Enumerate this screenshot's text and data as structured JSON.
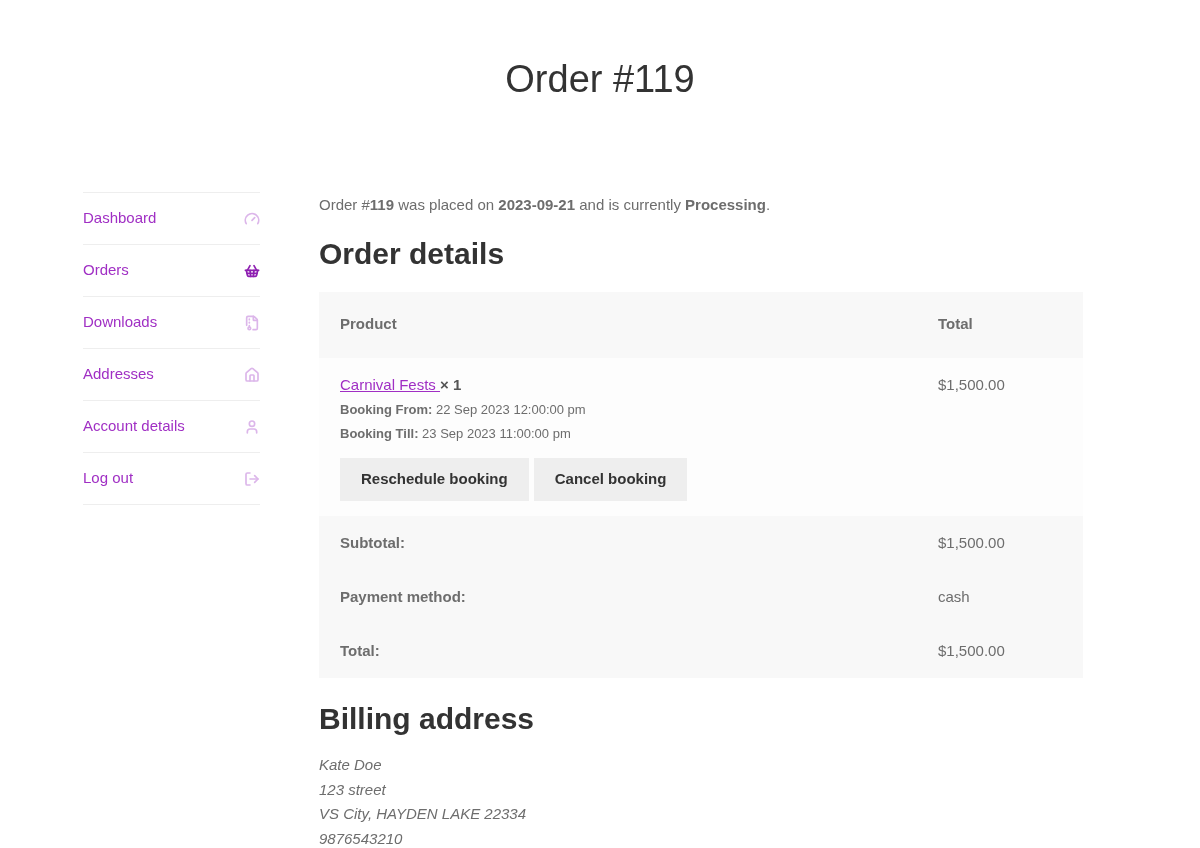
{
  "title": "Order #119",
  "nav": [
    {
      "label": "Dashboard",
      "kind": "dashboard",
      "selected": false
    },
    {
      "label": "Orders",
      "kind": "orders",
      "selected": true
    },
    {
      "label": "Downloads",
      "kind": "downloads",
      "selected": false
    },
    {
      "label": "Addresses",
      "kind": "addresses",
      "selected": false
    },
    {
      "label": "Account details",
      "kind": "account",
      "selected": false
    },
    {
      "label": "Log out",
      "kind": "logout",
      "selected": false
    }
  ],
  "intro": "Order #**119** was placed on **2023-09-21** and is currently **Processing**.",
  "order_details": {
    "heading": "Order details",
    "columns": [
      "Product",
      "Total"
    ],
    "item": {
      "product": "Carnival Fests ",
      "quantity": "× 1",
      "meta": [
        "**Booking From:** 22 Sep 2023 12:00:00 pm",
        "**Booking Till:** 23 Sep 2023 11:00:00 pm"
      ],
      "total": "$1,500.00",
      "buttons": [
        "Reschedule booking",
        "Cancel booking"
      ]
    },
    "totals": [
      {
        "label": "Subtotal:",
        "value": "$1,500.00"
      },
      {
        "label": "Payment method:",
        "value": "cash"
      },
      {
        "label": "Total:",
        "value": "$1,500.00"
      }
    ]
  },
  "billing": {
    "heading": "Billing address",
    "lines": [
      "Kate Doe",
      "123 street",
      "VS City, HAYDEN LAKE 22334",
      "9876543210"
    ]
  }
}
